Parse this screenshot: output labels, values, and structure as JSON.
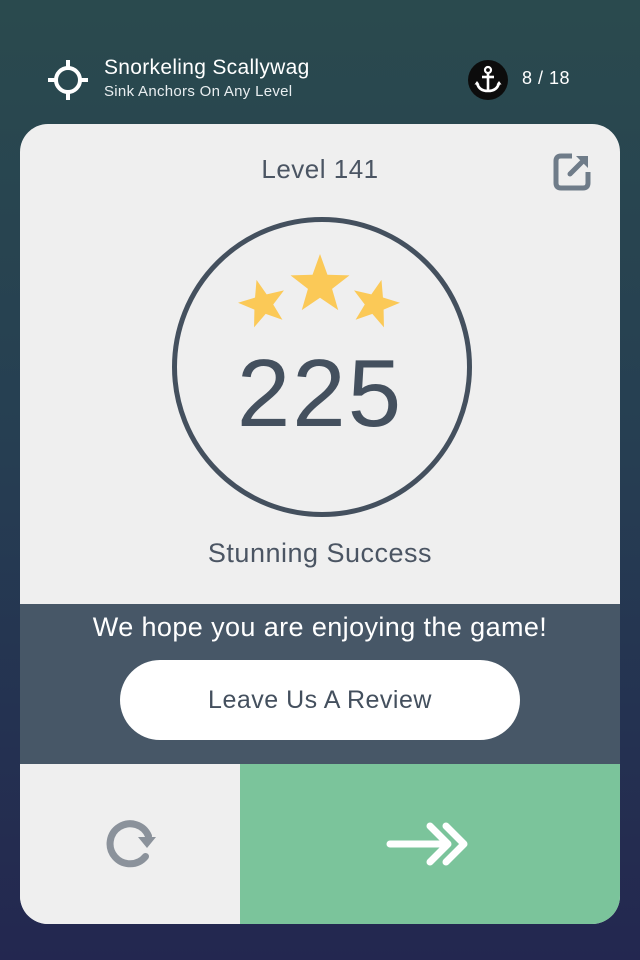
{
  "achievement": {
    "title": "Snorkeling Scallywag",
    "subtitle": "Sink Anchors On Any Level",
    "icon": "crosshair-icon",
    "anchor_icon": "anchor-icon",
    "progress_text": "8 / 18",
    "progress": {
      "current": 8,
      "total": 18
    }
  },
  "result": {
    "level_label": "Level 141",
    "score": "225",
    "stars": 3,
    "star_color": "#fbc957",
    "rating_text": "Stunning Success",
    "share_icon": "share-icon"
  },
  "review": {
    "message": "We hope you are enjoying the game!",
    "button_label": "Leave Us A Review"
  },
  "actions": {
    "replay_icon": "replay-icon",
    "next_icon": "next-arrow-icon",
    "next_color": "#7bc49b"
  }
}
